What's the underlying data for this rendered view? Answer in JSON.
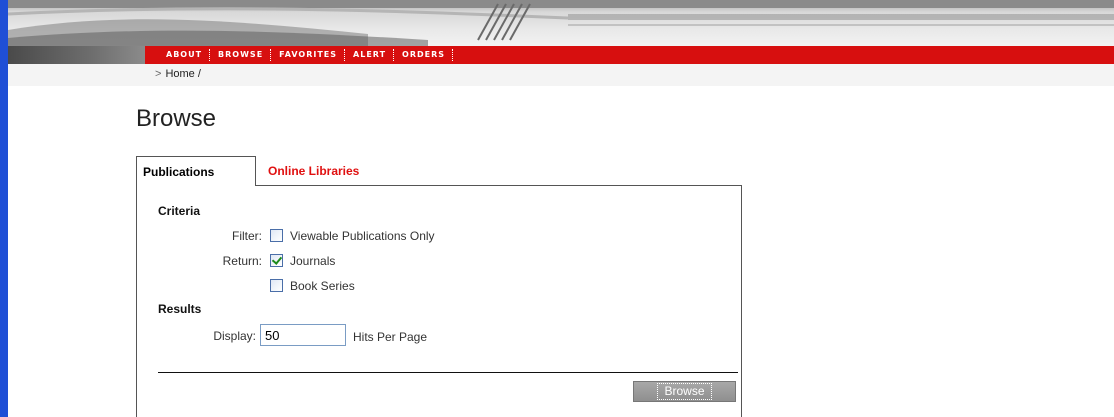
{
  "nav": {
    "items": [
      "ABOUT",
      "BROWSE",
      "FAVORITES",
      "ALERT",
      "ORDERS"
    ]
  },
  "breadcrumb": {
    "arrow": ">",
    "text": "Home /"
  },
  "page": {
    "title": "Browse"
  },
  "tabs": [
    {
      "label": "Publications",
      "active": true
    },
    {
      "label": "Online Libraries",
      "active": false
    }
  ],
  "form": {
    "criteria_heading": "Criteria",
    "filter_label": "Filter:",
    "filter_option": "Viewable Publications Only",
    "filter_checked": false,
    "return_label": "Return:",
    "return_journals": "Journals",
    "return_journals_checked": true,
    "return_books": "Book Series",
    "return_books_checked": false,
    "results_heading": "Results",
    "display_label": "Display:",
    "display_value": "50",
    "hits_label": "Hits Per Page",
    "browse_button": "Browse"
  },
  "colors": {
    "accent_red": "#d70f0f",
    "tab_link_red": "#e01010",
    "left_bar_blue": "#1f4fd6"
  }
}
